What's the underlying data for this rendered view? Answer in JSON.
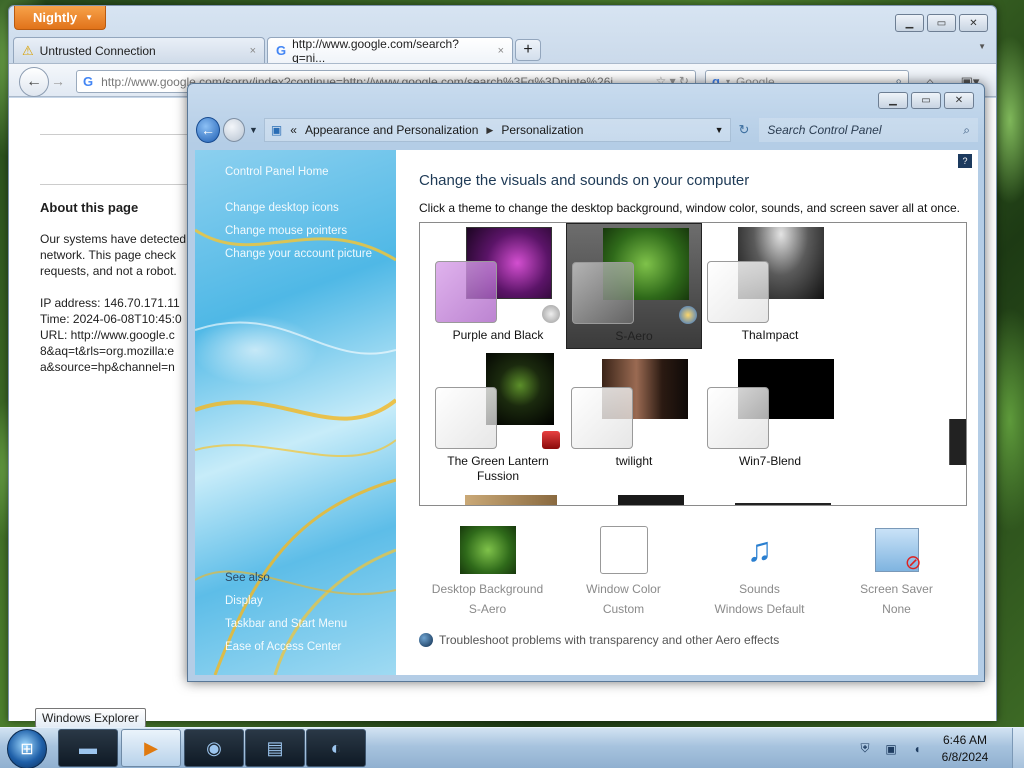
{
  "firefox": {
    "app_button": "Nightly",
    "tabs": [
      {
        "title": "Untrusted Connection",
        "close": "×"
      },
      {
        "title": "http://www.google.com/search?q=ni...",
        "close": "×"
      }
    ],
    "new_tab": "+",
    "url": "http://www.google.com/sorry/index?continue=http://www.google.com/search%3Fq%3Dninte%26i",
    "search_placeholder": "Google",
    "content": {
      "heading": "About this page",
      "body": "Our systems have detected\nnetwork. This page check\nrequests, and not a robot.\n\nIP address: 146.70.171.11\nTime: 2024-06-08T10:45:0\nURL: http://www.google.c\n8&aq=t&rls=org.mozilla:e\na&source=hp&channel=n"
    }
  },
  "control_panel": {
    "breadcrumb": {
      "prefix": "«",
      "items": [
        "Appearance and Personalization",
        "Personalization"
      ]
    },
    "search_placeholder": "Search Control Panel",
    "sidebar": {
      "links": [
        "Control Panel Home",
        "Change desktop icons",
        "Change mouse pointers",
        "Change your account picture"
      ],
      "see_also_heading": "See also",
      "see_also_links": [
        "Display",
        "Taskbar and Start Menu",
        "Ease of Access Center"
      ]
    },
    "title": "Change the visuals and sounds on your computer",
    "subtitle": "Click a theme to change the desktop background, window color, sounds, and screen saver all at once.",
    "themes": [
      {
        "name": "Purple and Black",
        "selected": false
      },
      {
        "name": "S-Aero",
        "selected": true
      },
      {
        "name": "ThaImpact",
        "selected": false
      },
      {
        "name": "The Green Lantern Fussion",
        "selected": false
      },
      {
        "name": "twilight",
        "selected": false
      },
      {
        "name": "Win7-Blend",
        "selected": false
      }
    ],
    "settings": [
      {
        "title": "Desktop Background",
        "value": "S-Aero"
      },
      {
        "title": "Window Color",
        "value": "Custom"
      },
      {
        "title": "Sounds",
        "value": "Windows Default"
      },
      {
        "title": "Screen Saver",
        "value": "None"
      }
    ],
    "troubleshoot": "Troubleshoot problems with transparency and other Aero effects"
  },
  "taskbar": {
    "tooltip": "Windows Explorer",
    "clock": {
      "time": "6:46 AM",
      "date": "6/8/2024"
    }
  },
  "colors": {
    "nightly_orange": "#e1731a",
    "aero_blue": "#1f5fb4",
    "selected_theme": "#3b3b3b"
  },
  "icons": {
    "warning": "warning-icon",
    "google": "google-icon",
    "search": "search-icon",
    "home": "home-icon",
    "back": "back-arrow-icon",
    "refresh": "refresh-icon"
  }
}
